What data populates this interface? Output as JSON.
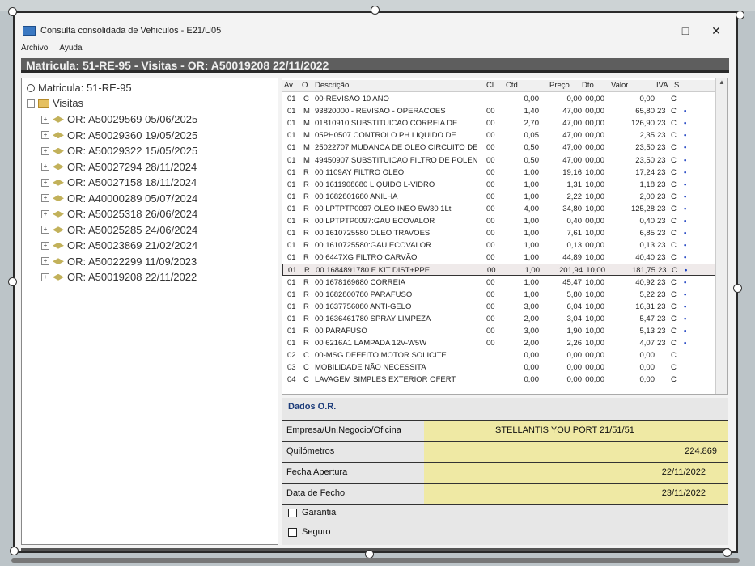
{
  "window": {
    "title": "Consulta consolidada de Vehiculos - E21/U05",
    "minimize": "–",
    "maximize": "□",
    "close": "✕"
  },
  "menu": [
    "Archivo",
    "Ayuda"
  ],
  "infobar": "Matricula: 51-RE-95 - Visitas - OR: A50019208 22/11/2022",
  "tree": {
    "root": "Matricula: 51-RE-95",
    "visitas": "Visitas",
    "items": [
      "OR: A50029569 05/06/2025",
      "OR: A50029360 19/05/2025",
      "OR: A50029322 15/05/2025",
      "OR: A50027294 28/11/2024",
      "OR: A50027158 18/11/2024",
      "OR: A40000289 05/07/2024",
      "OR: A50025318 26/06/2024",
      "OR: A50025285 24/06/2024",
      "OR: A50023869 21/02/2024",
      "OR: A50022299 11/09/2023",
      "OR: A50019208 22/11/2022"
    ]
  },
  "grid": {
    "headers": [
      "Av",
      "O",
      "Descrição",
      "Cl",
      "Ctd.",
      "Preço",
      "Dto.",
      "Valor",
      "IVA",
      "S"
    ],
    "rows": [
      [
        "01",
        "C",
        "00-REVISÃO 10 ANO",
        "",
        "0,00",
        "0,00",
        "00,00",
        "0,00",
        "",
        "C",
        ""
      ],
      [
        "01",
        "M",
        "93820000  - REVISAO - OPERACOES",
        "00",
        "1,40",
        "47,00",
        "00,00",
        "65,80",
        "23",
        "C",
        "•"
      ],
      [
        "01",
        "M",
        "01810910  SUBSTITUICAO CORREIA DE",
        "00",
        "2,70",
        "47,00",
        "00,00",
        "126,90",
        "23",
        "C",
        "•"
      ],
      [
        "01",
        "M",
        "05PH0507  CONTROLO PH LIQUIDO DE",
        "00",
        "0,05",
        "47,00",
        "00,00",
        "2,35",
        "23",
        "C",
        "•"
      ],
      [
        "01",
        "M",
        "25022707  MUDANCA DE OLEO CIRCUITO DE",
        "00",
        "0,50",
        "47,00",
        "00,00",
        "23,50",
        "23",
        "C",
        "•"
      ],
      [
        "01",
        "M",
        "49450907  SUBSTITUICAO FILTRO DE POLEN",
        "00",
        "0,50",
        "47,00",
        "00,00",
        "23,50",
        "23",
        "C",
        "•"
      ],
      [
        "01",
        "R",
        "00 1109AY FILTRO OLEO",
        "00",
        "1,00",
        "19,16",
        "10,00",
        "17,24",
        "23",
        "C",
        "•"
      ],
      [
        "01",
        "R",
        "00 1611908680 LIQUIDO L-VIDRO",
        "00",
        "1,00",
        "1,31",
        "10,00",
        "1,18",
        "23",
        "C",
        "•"
      ],
      [
        "01",
        "R",
        "00 1682801680 ANILHA",
        "00",
        "1,00",
        "2,22",
        "10,00",
        "2,00",
        "23",
        "C",
        "•"
      ],
      [
        "01",
        "R",
        "00 LPTPTP0097 ÓLEO INEO 5W30 1Lt",
        "00",
        "4,00",
        "34,80",
        "10,00",
        "125,28",
        "23",
        "C",
        "•"
      ],
      [
        "01",
        "R",
        "00 LPTPTP0097:GAU ECOVALOR",
        "00",
        "1,00",
        "0,40",
        "00,00",
        "0,40",
        "23",
        "C",
        "•"
      ],
      [
        "01",
        "R",
        "00 1610725580 OLEO TRAVOES",
        "00",
        "1,00",
        "7,61",
        "10,00",
        "6,85",
        "23",
        "C",
        "•"
      ],
      [
        "01",
        "R",
        "00 1610725580:GAU ECOVALOR",
        "00",
        "1,00",
        "0,13",
        "00,00",
        "0,13",
        "23",
        "C",
        "•"
      ],
      [
        "01",
        "R",
        "00 6447XG  FILTRO CARVÃO",
        "00",
        "1,00",
        "44,89",
        "10,00",
        "40,40",
        "23",
        "C",
        "•"
      ],
      [
        "01",
        "R",
        "00 1684891780 E.KIT DIST+PPE",
        "00",
        "1,00",
        "201,94",
        "10,00",
        "181,75",
        "23",
        "C",
        "•"
      ],
      [
        "01",
        "R",
        "00 1678169680 CORREIA",
        "00",
        "1,00",
        "45,47",
        "10,00",
        "40,92",
        "23",
        "C",
        "•"
      ],
      [
        "01",
        "R",
        "00 1682800780 PARAFUSO",
        "00",
        "1,00",
        "5,80",
        "10,00",
        "5,22",
        "23",
        "C",
        "•"
      ],
      [
        "01",
        "R",
        "00 1637756080 ANTI-GELO",
        "00",
        "3,00",
        "6,04",
        "10,00",
        "16,31",
        "23",
        "C",
        "•"
      ],
      [
        "01",
        "R",
        "00 1636461780 SPRAY LIMPEZA",
        "00",
        "2,00",
        "3,04",
        "10,00",
        "5,47",
        "23",
        "C",
        "•"
      ],
      [
        "01",
        "R",
        "00 PARAFUSO",
        "00",
        "3,00",
        "1,90",
        "10,00",
        "5,13",
        "23",
        "C",
        "•"
      ],
      [
        "01",
        "R",
        "00 6216A1 LAMPADA 12V-W5W",
        "00",
        "2,00",
        "2,26",
        "10,00",
        "4,07",
        "23",
        "C",
        "•"
      ],
      [
        "02",
        "C",
        "00-MSG DEFEITO MOTOR SOLICITE",
        "",
        "0,00",
        "0,00",
        "00,00",
        "0,00",
        "",
        "C",
        ""
      ],
      [
        "03",
        "C",
        "MOBILIDADE NÃO NECESSITA",
        "",
        "0,00",
        "0,00",
        "00,00",
        "0,00",
        "",
        "C",
        ""
      ],
      [
        "04",
        "C",
        "LAVAGEM SIMPLES EXTERIOR OFERT",
        "",
        "0,00",
        "0,00",
        "00,00",
        "0,00",
        "",
        "C",
        ""
      ]
    ]
  },
  "dados": {
    "title": "Dados O.R.",
    "empresa_label": "Empresa/Un.Negocio/Oficina",
    "empresa_value": "STELLANTIS YOU PORT 21/51/51",
    "km_label": "Quilómetros",
    "km_value": "224.869",
    "abertura_label": "Fecha Apertura",
    "abertura_value": "22/11/2022",
    "fecho_label": "Data de Fecho",
    "fecho_value": "23/11/2022",
    "garantia_label": "Garantia",
    "seguro_label": "Seguro"
  }
}
